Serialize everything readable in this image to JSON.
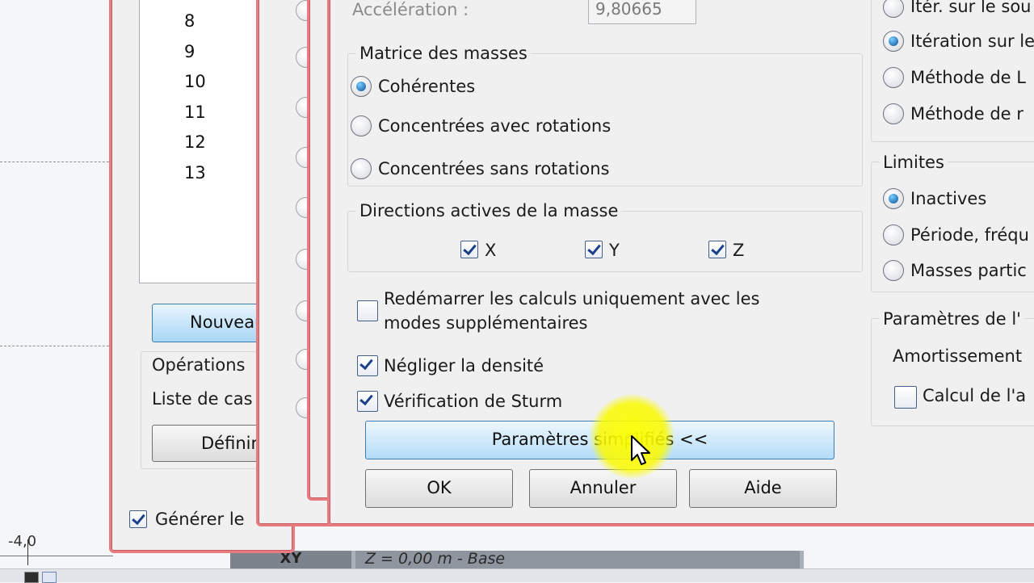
{
  "left_dialog": {
    "list_numbers": [
      "8",
      "9",
      "10",
      "11",
      "12",
      "13"
    ],
    "nouveau_button": "Nouveau",
    "operations_group": "Opérations",
    "liste_label": "Liste de cas",
    "definir_button": "Définir",
    "generer_checkbox": "Générer le",
    "generer_checked": true
  },
  "main_dialog": {
    "acceleration_label": "Accélération :",
    "acceleration_value": "9,80665",
    "masses_group": {
      "title": "Matrice des masses",
      "options": [
        "Cohérentes",
        "Concentrées avec rotations",
        "Concentrées sans rotations"
      ],
      "selected": "Cohérentes"
    },
    "directions_group": {
      "title": "Directions actives de la masse",
      "x_label": "X",
      "y_label": "Y",
      "z_label": "Z",
      "x_checked": true,
      "y_checked": true,
      "z_checked": true
    },
    "redemarrer_line1": "Redémarrer les calculs uniquement avec les",
    "redemarrer_line2": "modes supplémentaires",
    "redemarrer_checked": false,
    "negliger_label": "Négliger la densité",
    "negliger_checked": true,
    "sturm_label": "Vérification de Sturm",
    "sturm_checked": true,
    "simplified_button": "Paramètres simplifiés <<",
    "ok_button": "OK",
    "annuler_button": "Annuler",
    "aide_button": "Aide"
  },
  "right_panel": {
    "method_options": [
      "Itér. sur le sou",
      "Itération sur le",
      "Méthode de L",
      "Méthode de r"
    ],
    "method_selected": "Itération sur le",
    "limites_title": "Limites",
    "limites_options": [
      "Inactives",
      "Période, fréqu",
      "Masses partic"
    ],
    "limites_selected": "Inactives",
    "params_title": "Paramètres de l'",
    "amortissement_label": "Amortissement",
    "calcul_label": "Calcul de l'a",
    "calcul_checked": false
  },
  "background": {
    "axis_value": "-4,0",
    "tab_xy": "XY",
    "tab_z": "Z = 0,00 m - Base"
  },
  "colors": {
    "dialog_border": "#e77b80",
    "highlight": "#ffff00",
    "accent_button": "#b4dcf7"
  }
}
